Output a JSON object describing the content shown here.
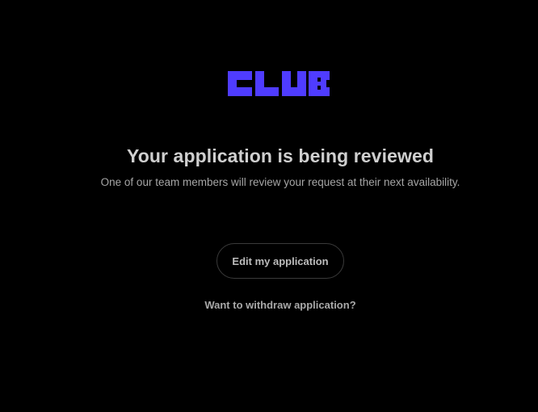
{
  "brand": {
    "logo_text": "CLUB",
    "logo_color": "#4f3cff"
  },
  "status": {
    "title": "Your application is being reviewed",
    "message": "One of our team members will review your request at their next availability."
  },
  "actions": {
    "edit_label": "Edit my application",
    "withdraw_label": "Want to withdraw application?"
  },
  "colors": {
    "background": "#000000",
    "title": "#cfcfcf",
    "text": "#a6a6a6",
    "button_border": "#3a3a3a"
  }
}
